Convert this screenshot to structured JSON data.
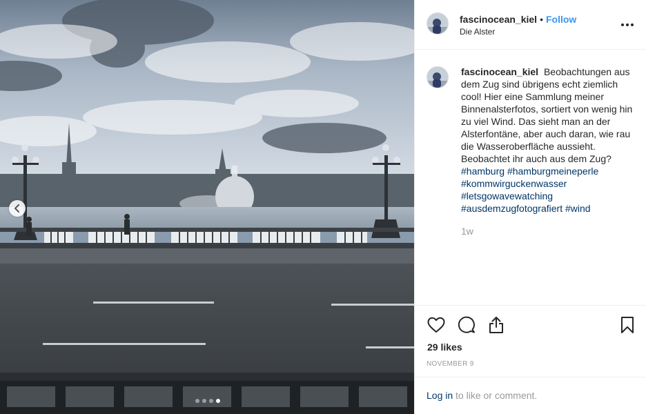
{
  "post": {
    "username": "fascinocean_kiel",
    "separator": "•",
    "follow_label": "Follow",
    "location": "Die Alster",
    "caption": {
      "username": "fascinocean_kiel",
      "text": "Beobachtungen aus dem Zug sind übrigens echt ziemlich cool! Hier eine Sammlung meiner Binnenalsterfotos, sortiert von wenig hin zu viel Wind. Das sieht man an der Alsterfontäne, aber auch daran, wie rau die Wasseroberfläche aussieht. Beobachtet ihr auch aus dem Zug?",
      "hashtags": [
        "#hamburg",
        "#hamburgmeineperle",
        "#kommwirguckenwasser",
        "#letsgowavewatching",
        "#ausdemzugfotografiert",
        "#wind"
      ]
    },
    "time_ago": "1w",
    "likes": "29 likes",
    "date": "NOVEMBER 9",
    "login": {
      "link": "Log in",
      "suffix": "to like or comment."
    }
  },
  "carousel": {
    "slides": 4,
    "active_index": 3
  },
  "icons": {
    "prev": "chevron-left-icon",
    "more": "more-options-icon",
    "like": "heart-icon",
    "comment": "comment-icon",
    "share": "share-icon",
    "save": "bookmark-icon"
  },
  "colors": {
    "link_blue": "#3897f0",
    "hashtag": "#003569",
    "muted": "#999999",
    "text": "#262626"
  }
}
